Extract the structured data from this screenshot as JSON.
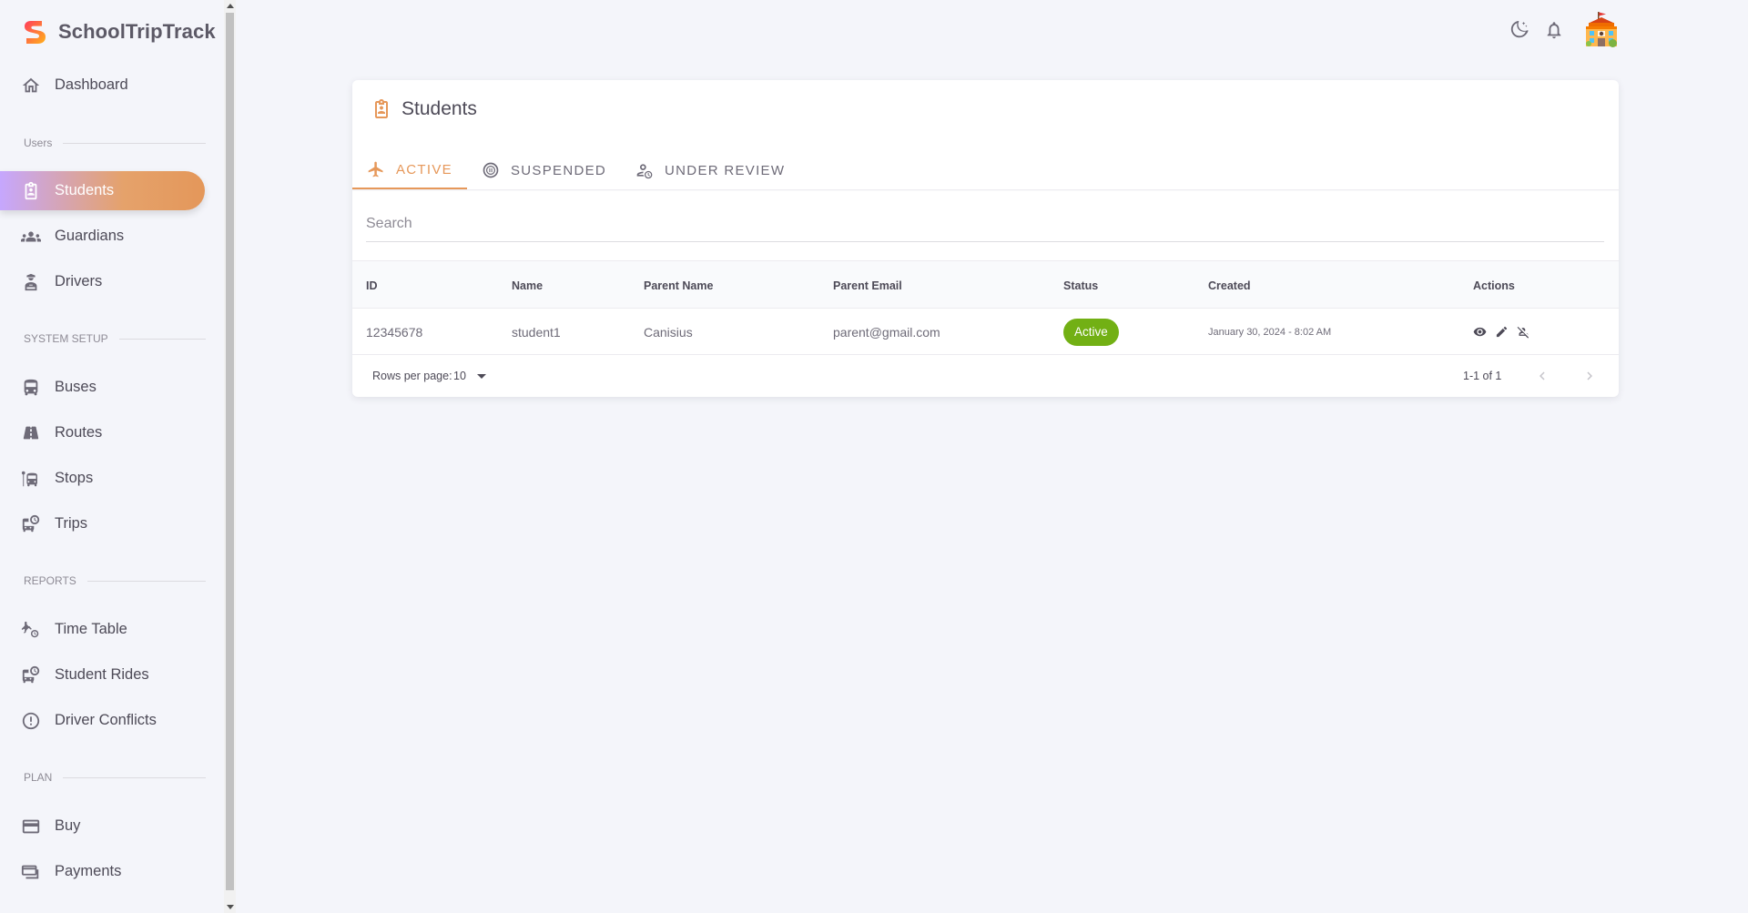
{
  "brand": {
    "name": "SchoolTripTrack"
  },
  "sidebar": {
    "dashboard": "Dashboard",
    "sections": {
      "users": "Users",
      "system_setup": "SYSTEM SETUP",
      "reports": "REPORTS",
      "plan": "PLAN"
    },
    "items": {
      "students": "Students",
      "guardians": "Guardians",
      "drivers": "Drivers",
      "buses": "Buses",
      "routes": "Routes",
      "stops": "Stops",
      "trips": "Trips",
      "time_table": "Time Table",
      "student_rides": "Student Rides",
      "driver_conflicts": "Driver Conflicts",
      "buy": "Buy",
      "payments": "Payments"
    }
  },
  "card": {
    "title": "Students",
    "tabs": [
      "ACTIVE",
      "SUSPENDED",
      "UNDER REVIEW"
    ],
    "search": {
      "placeholder": "Search",
      "value": ""
    },
    "columns": [
      "ID",
      "Name",
      "Parent Name",
      "Parent Email",
      "Status",
      "Created",
      "Actions"
    ],
    "rows": [
      {
        "id": "12345678",
        "name": "student1",
        "parent_name": "Canisius",
        "parent_email": "parent@gmail.com",
        "status": "Active",
        "created": "January 30, 2024 - 8:02 AM"
      }
    ],
    "pagination": {
      "rows_per_page_label": "Rows per page:",
      "rows_per_page": "10",
      "range": "1-1 of 1"
    }
  },
  "colors": {
    "accent": "#e6985a",
    "status_active": "#72b014",
    "active_gradient_start": "#c6a7fe",
    "active_gradient_end": "#e4975a"
  }
}
